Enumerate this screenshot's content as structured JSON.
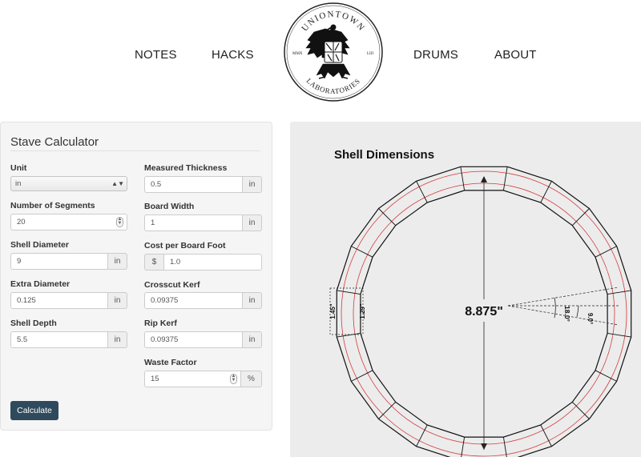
{
  "nav": {
    "notes": "NOTES",
    "hacks": "HACKS",
    "drums": "DRUMS",
    "about": "ABOUT"
  },
  "logo": {
    "top_text": "UNIONTOWN",
    "bottom_text": "LABORATORIES",
    "left_mark": "MMX",
    "right_mark": "LIII"
  },
  "form": {
    "title": "Stave Calculator",
    "unit": {
      "label": "Unit",
      "value": "in"
    },
    "segments": {
      "label": "Number of Segments",
      "value": "20"
    },
    "shell_diameter": {
      "label": "Shell Diameter",
      "value": "9",
      "unit": "in"
    },
    "extra_diameter": {
      "label": "Extra Diameter",
      "value": "0.125",
      "unit": "in"
    },
    "shell_depth": {
      "label": "Shell Depth",
      "value": "5.5",
      "unit": "in"
    },
    "measured_thickness": {
      "label": "Measured Thickness",
      "value": "0.5",
      "unit": "in"
    },
    "board_width": {
      "label": "Board Width",
      "value": "1",
      "unit": "in"
    },
    "cost_per_board_foot": {
      "label": "Cost per Board Foot",
      "value": "1.0",
      "prefix": "$"
    },
    "crosscut_kerf": {
      "label": "Crosscut Kerf",
      "value": "0.09375",
      "unit": "in"
    },
    "rip_kerf": {
      "label": "Rip Kerf",
      "value": "0.09375",
      "unit": "in"
    },
    "waste_factor": {
      "label": "Waste Factor",
      "value": "15",
      "unit": "%"
    },
    "calculate_label": "Calculate"
  },
  "diagram": {
    "title": "Shell Dimensions",
    "diameter_label": "8.875\"",
    "outer_width_label": "1.45\"",
    "inner_width_label": "1.29\"",
    "segment_angle_label": "18.0°",
    "half_angle_label": "9.0°",
    "segments": 20,
    "stroke_color": "#111111",
    "accent_color": "#d33a3a"
  }
}
